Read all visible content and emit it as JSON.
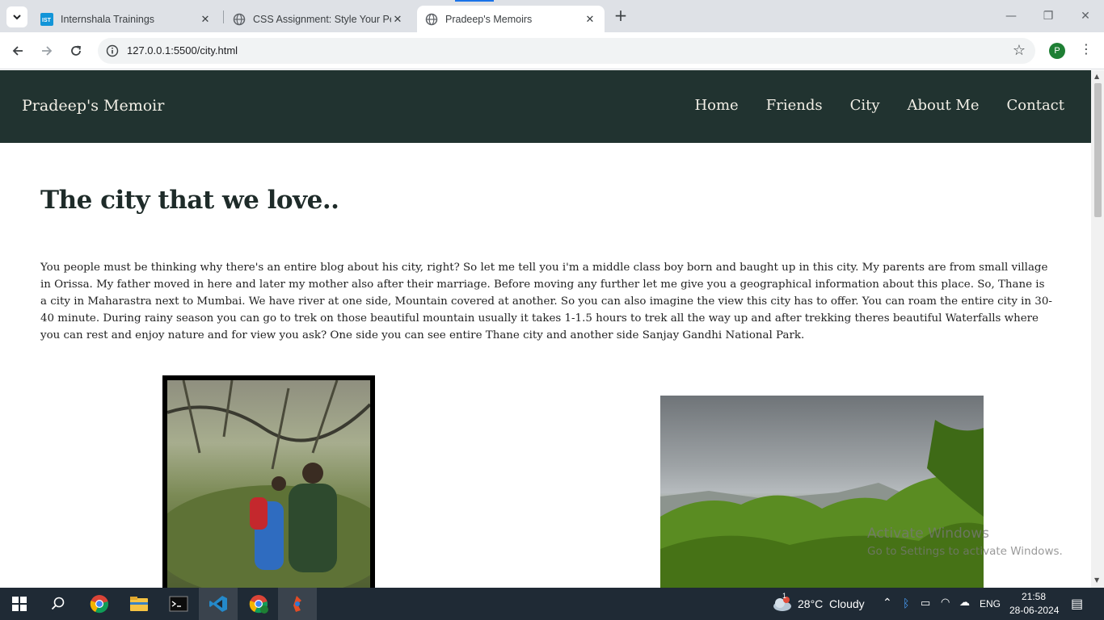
{
  "browser": {
    "tabs": [
      {
        "title": "Internshala Trainings",
        "active": false
      },
      {
        "title": "CSS Assignment: Style Your Pers",
        "active": false
      },
      {
        "title": "Pradeep's Memoirs",
        "active": true
      }
    ],
    "url": "127.0.0.1:5500/city.html",
    "profile_initial": "P"
  },
  "site": {
    "brand": "Pradeep's Memoir",
    "menu": [
      "Home",
      "Friends",
      "City",
      "About Me",
      "Contact"
    ],
    "heading": "The city that we love..",
    "paragraph": "You people must be thinking why there's an entire blog about his city, right? So let me tell you i'm a middle class boy born and baught up in this city. My parents are from small village in Orissa. My father moved in here and later my mother also after their marriage. Before moving any further let me give you a geographical information about this place. So, Thane is a city in Maharastra next to Mumbai. We have river at one side, Mountain covered at another. So you can also imagine the view this city has to offer. You can roam the entire city in 30-40 minute. During rainy season you can go to trek on those beautiful mountain usually it takes 1-1.5 hours to trek all the way up and after trekking theres beautiful Waterfalls where you can rest and enjoy nature and for view you ask? One side you can see entire Thane city and another side Sanjay Gandhi National Park."
  },
  "watermark": {
    "line1": "Activate Windows",
    "line2": "Go to Settings to activate Windows."
  },
  "taskbar": {
    "weather": "28°C  Cloudy",
    "weather_badge": "1",
    "language": "ENG",
    "time": "21:58",
    "date": "28-06-2024"
  }
}
